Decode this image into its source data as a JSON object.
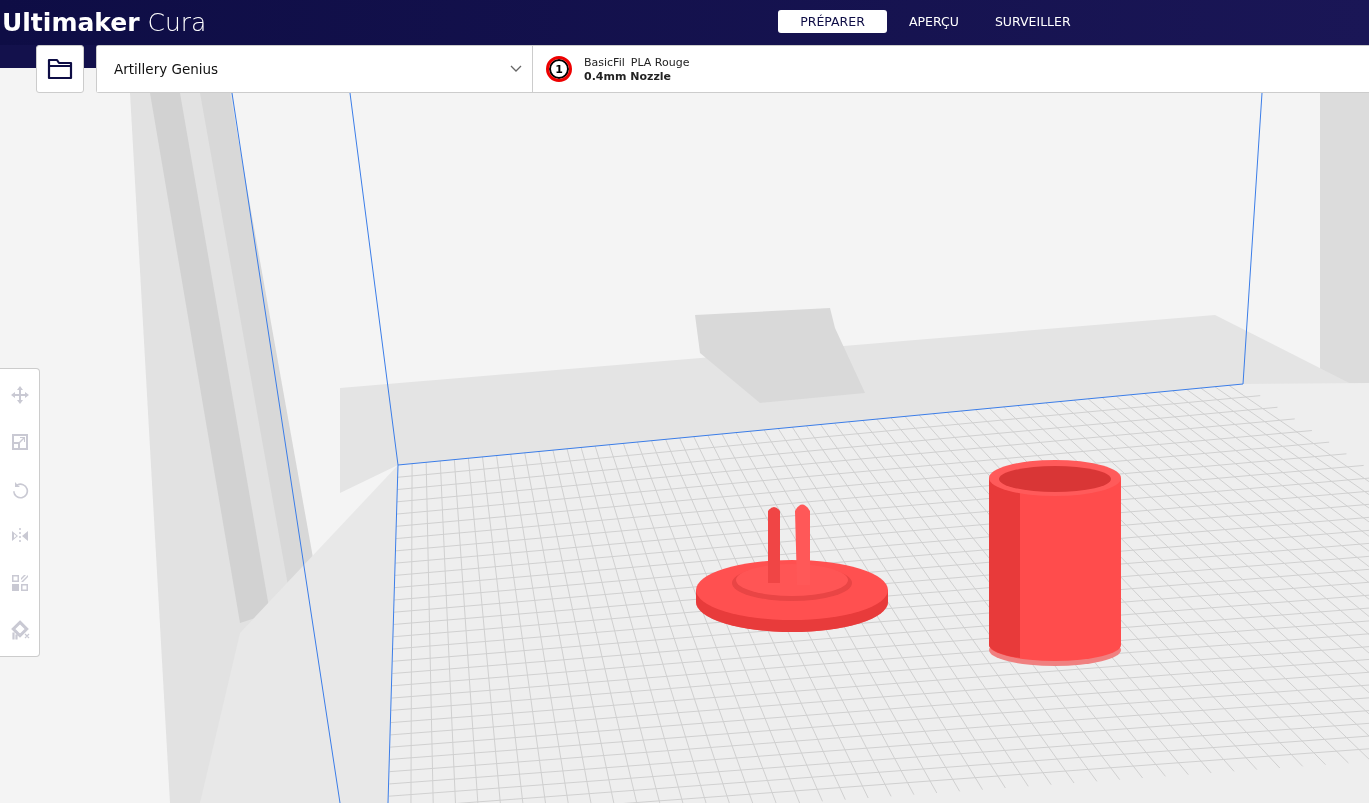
{
  "header": {
    "logo": "**Ultimaker** Cura",
    "tabs": [
      {
        "label": "PRÉPARER",
        "selected": true
      },
      {
        "label": "APERÇU",
        "selected": false
      },
      {
        "label": "SURVEILLER",
        "selected": false
      }
    ]
  },
  "printer_selector": {
    "value": "Artillery Genius"
  },
  "extruder": {
    "number": "1",
    "brand": "BasicFil",
    "material": "PLA Rouge",
    "nozzle": "0.4mm Nozzle"
  },
  "tools": [
    {
      "kind": "move",
      "disabled": true
    },
    {
      "kind": "scale",
      "disabled": true
    },
    {
      "kind": "rotate",
      "disabled": true
    },
    {
      "kind": "mirror",
      "disabled": true
    },
    {
      "kind": "per-model",
      "disabled": true
    },
    {
      "kind": "support-blocker",
      "disabled": true
    }
  ]
}
